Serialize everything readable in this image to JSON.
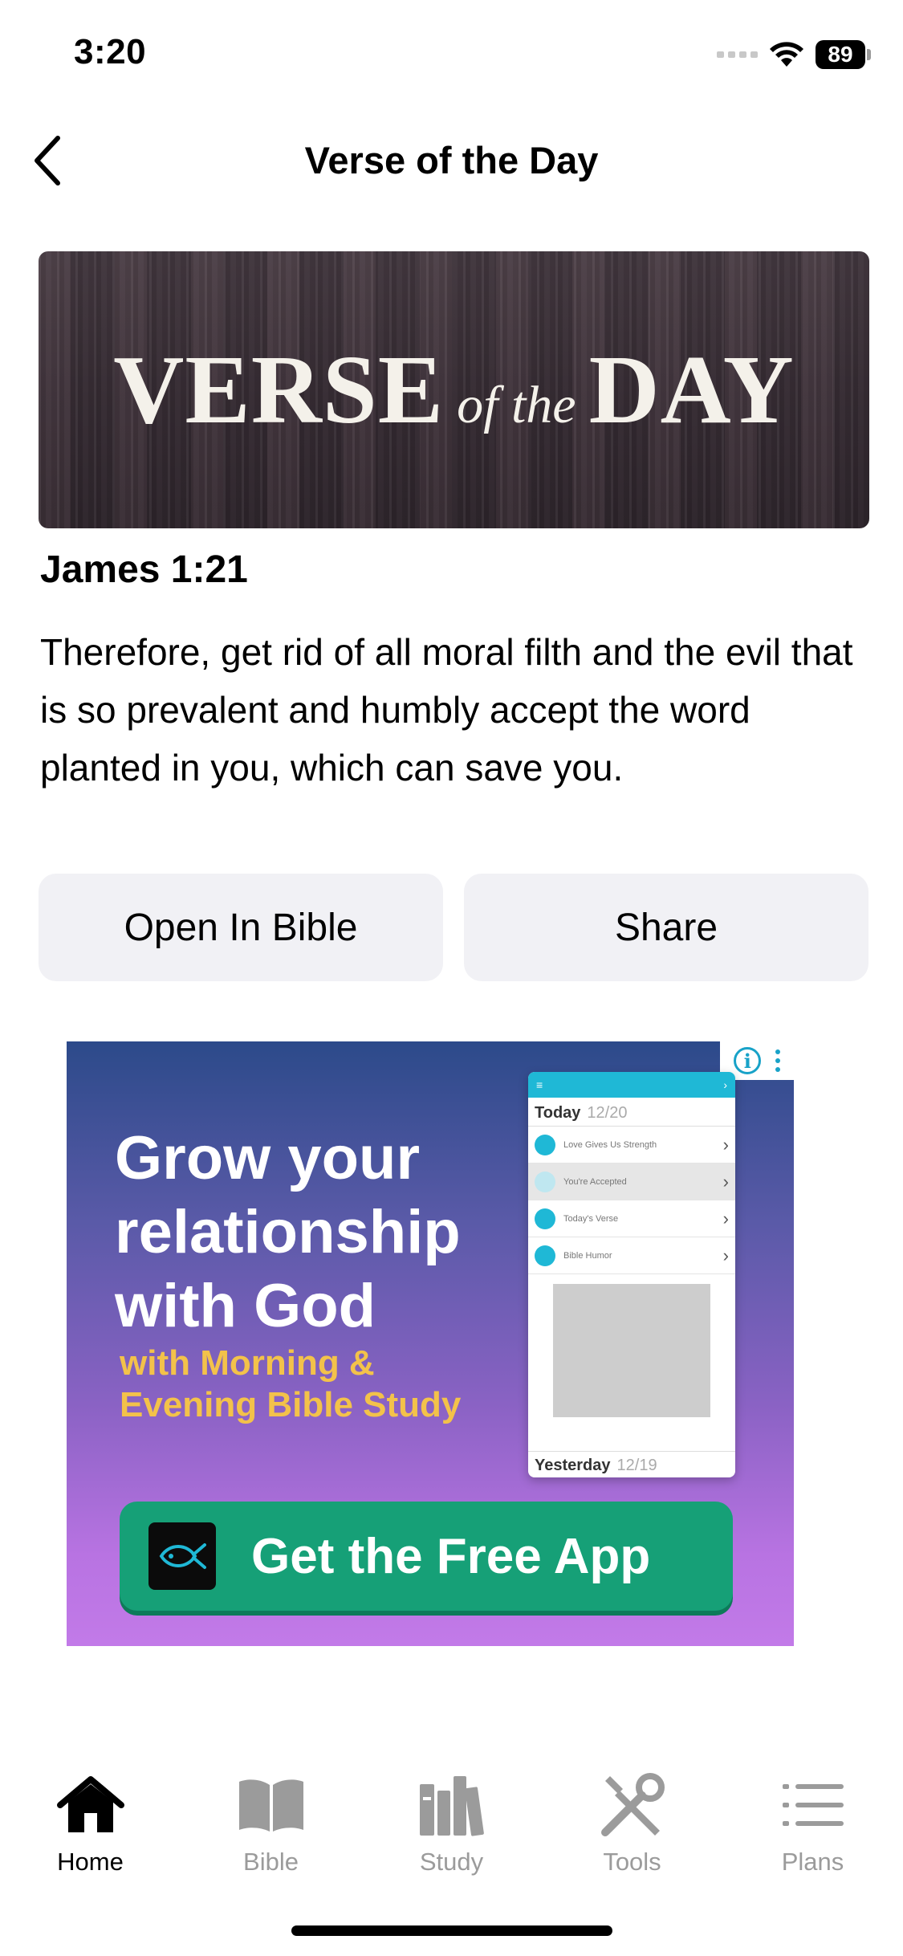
{
  "status_bar": {
    "time": "3:20",
    "battery": "89"
  },
  "nav": {
    "title": "Verse of the Day",
    "back_icon": "chevron-left-icon"
  },
  "banner": {
    "word_1": "VERSE",
    "word_2": "of the",
    "word_3": "DAY"
  },
  "verse": {
    "reference": "James 1:21",
    "text": "Therefore, get rid of all moral filth and the evil that is so prevalent and humbly accept the word planted in you, which can save you."
  },
  "actions": {
    "open_label": "Open In Bible",
    "share_label": "Share"
  },
  "ad": {
    "info_icon": "i",
    "headline_1": "Grow your",
    "headline_2": "relationship",
    "headline_3": "with God",
    "sub_1": "with Morning &",
    "sub_2": "Evening Bible Study",
    "phone_today": "Today",
    "phone_today_date": "12/20",
    "phone_rows": [
      "Love Gives Us Strength",
      "You're Accepted",
      "Today's Verse",
      "Bible Humor"
    ],
    "phone_yesterday": "Yesterday",
    "phone_yesterday_date": "12/19",
    "cta_label": "Get the Free App",
    "colors": {
      "cta": "#16a077",
      "accent": "#f3c24a",
      "phone_header": "#1fb8d6"
    }
  },
  "tabs": [
    {
      "label": "Home",
      "icon": "house-icon",
      "active": true
    },
    {
      "label": "Bible",
      "icon": "book-icon",
      "active": false
    },
    {
      "label": "Study",
      "icon": "books-icon",
      "active": false
    },
    {
      "label": "Tools",
      "icon": "tools-icon",
      "active": false
    },
    {
      "label": "Plans",
      "icon": "list-icon",
      "active": false
    }
  ]
}
